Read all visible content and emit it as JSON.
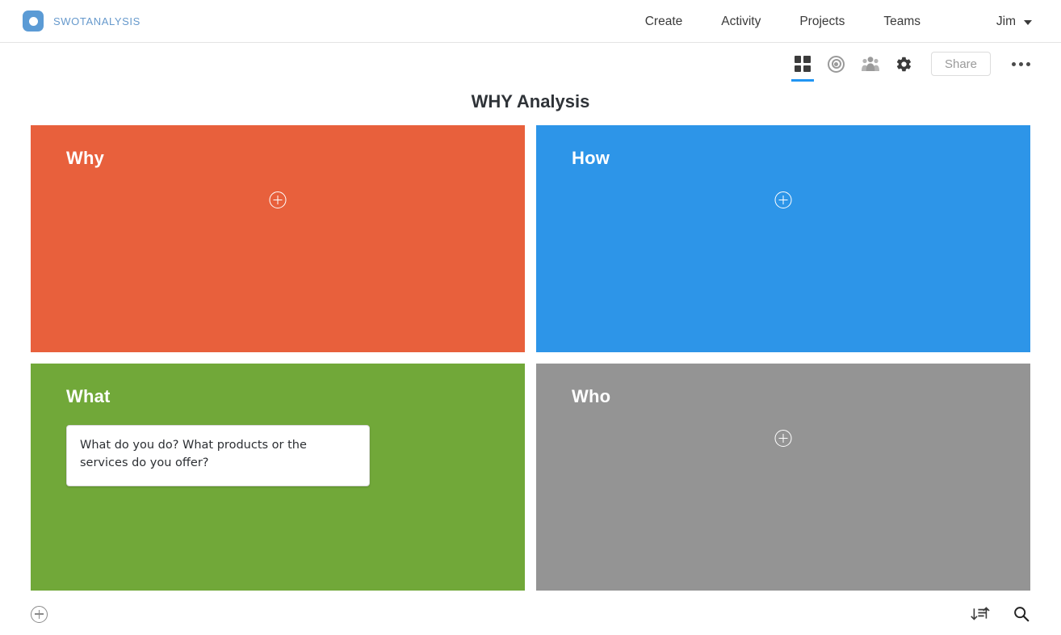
{
  "header": {
    "brand": "swotanalysis",
    "logo_icon": "rounded-square-dot-logo",
    "nav": [
      {
        "label": "Create"
      },
      {
        "label": "Activity"
      },
      {
        "label": "Projects"
      },
      {
        "label": "Teams"
      }
    ],
    "user": {
      "name": "Jim",
      "caret_icon": "chevron-down-icon"
    }
  },
  "toolbar": {
    "items": [
      {
        "name": "grid-view-icon",
        "active": true
      },
      {
        "name": "target-icon",
        "active": false
      },
      {
        "name": "people-group-icon",
        "active": false
      },
      {
        "name": "gear-icon",
        "active": false
      }
    ],
    "share_label": "Share",
    "more_icon": "ellipsis-icon",
    "active_accent": "#2196f3"
  },
  "main": {
    "title": "WHY Analysis",
    "quadrants": [
      {
        "id": "why",
        "label": "Why",
        "color": "#e8603c",
        "add_icon": "plus-circle-icon",
        "notes": []
      },
      {
        "id": "how",
        "label": "How",
        "color": "#2d95e8",
        "add_icon": "plus-circle-icon",
        "notes": []
      },
      {
        "id": "what",
        "label": "What",
        "color": "#71a839",
        "add_icon": null,
        "notes": [
          {
            "text": "What do you do? What products or the services do you offer?"
          }
        ]
      },
      {
        "id": "who",
        "label": "Who",
        "color": "#949494",
        "add_icon": "plus-circle-icon",
        "notes": []
      }
    ]
  },
  "footer": {
    "add_icon": "plus-circle-icon",
    "sort_icon": "sort-icon",
    "search_icon": "search-icon"
  }
}
